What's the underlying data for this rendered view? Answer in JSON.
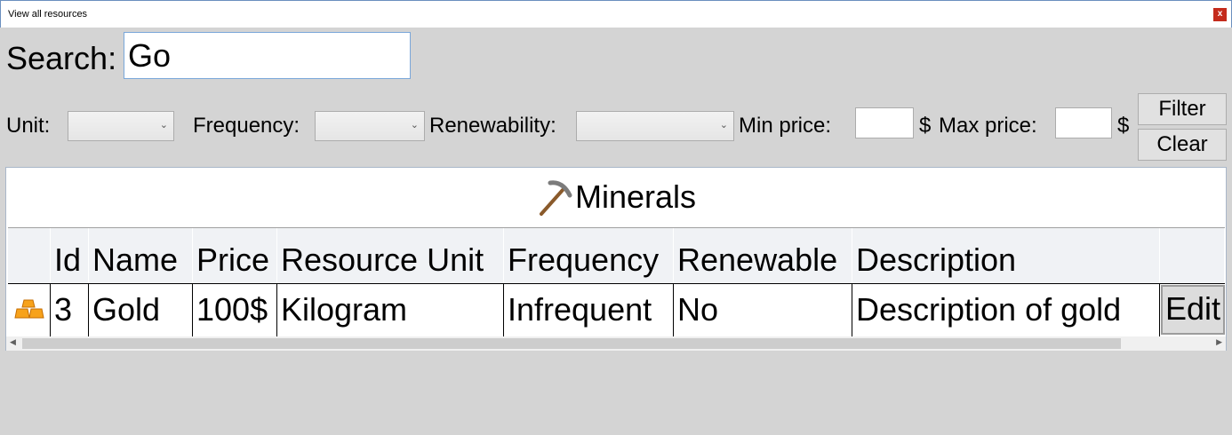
{
  "window": {
    "title": "View all resources",
    "close_label": "x"
  },
  "search": {
    "label": "Search:",
    "value": "Go"
  },
  "filters": {
    "unit_label": "Unit:",
    "frequency_label": "Frequency:",
    "renewability_label": "Renewability:",
    "min_price_label": "Min price:",
    "max_price_label": "Max price:",
    "currency": "$",
    "filter_button": "Filter",
    "clear_button": "Clear"
  },
  "panel": {
    "title": "Minerals",
    "icon": "pickaxe-icon",
    "columns": [
      "Id",
      "Name",
      "Price",
      "Resource Unit",
      "Frequency",
      "Renewable",
      "Description"
    ],
    "rows": [
      {
        "icon": "gold-bars-icon",
        "id": "3",
        "name": "Gold",
        "price": "100$",
        "unit": "Kilogram",
        "frequency": "Infrequent",
        "renewable": "No",
        "description": "Description of gold",
        "action": "Edit"
      }
    ]
  }
}
